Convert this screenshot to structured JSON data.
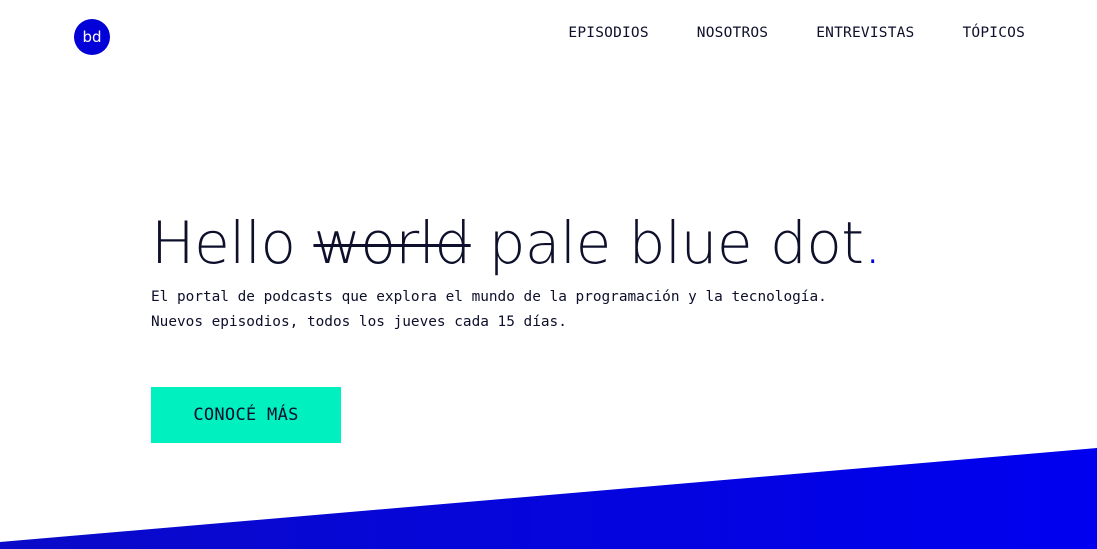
{
  "header": {
    "logo_text": "bd",
    "nav": [
      {
        "label": "EPISODIOS"
      },
      {
        "label": "NOSOTROS"
      },
      {
        "label": "ENTREVISTAS"
      },
      {
        "label": "TÓPICOS"
      }
    ]
  },
  "hero": {
    "headline_start": "Hello ",
    "headline_struck": "world",
    "headline_end": " pale blue dot",
    "headline_dot": ".",
    "subtitle": "El portal de podcasts que explora el mundo de la programación y la tecnología. Nuevos episodios, todos los jueves cada 15 días.",
    "cta_label": "CONOCÉ MÁS"
  },
  "colors": {
    "accent_blue": "#0202d8",
    "cta_green": "#00f0c0",
    "text_dark": "#0d0f2b"
  }
}
